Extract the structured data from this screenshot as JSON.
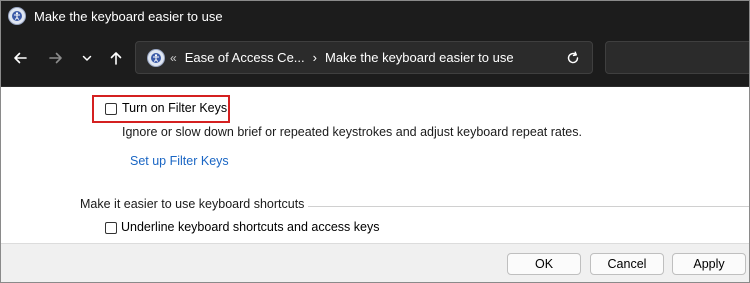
{
  "window": {
    "title": "Make the keyboard easier to use",
    "icon": "ease-of-access-icon"
  },
  "nav": {
    "back_icon": "back-arrow-icon",
    "forward_icon": "forward-arrow-icon",
    "recent_icon": "chevron-down-icon",
    "up_icon": "up-arrow-icon",
    "address": {
      "overflow": "«",
      "crumbs": [
        "Ease of Access Ce...",
        "Make the keyboard easier to use"
      ],
      "separator": "›",
      "refresh_icon": "refresh-icon"
    }
  },
  "content": {
    "filter_keys": {
      "label": "Turn on Filter Keys",
      "checked": false,
      "description": "Ignore or slow down brief or repeated keystrokes and adjust keyboard repeat rates.",
      "setup_link": "Set up Filter Keys"
    },
    "shortcuts_section": {
      "title": "Make it easier to use keyboard shortcuts",
      "underline_label": "Underline keyboard shortcuts and access keys",
      "underline_checked": false
    }
  },
  "footer": {
    "ok": "OK",
    "cancel": "Cancel",
    "apply": "Apply"
  },
  "colors": {
    "titlebar": "#1c1c1c",
    "highlight": "#d42020",
    "link": "#1a66c4"
  }
}
